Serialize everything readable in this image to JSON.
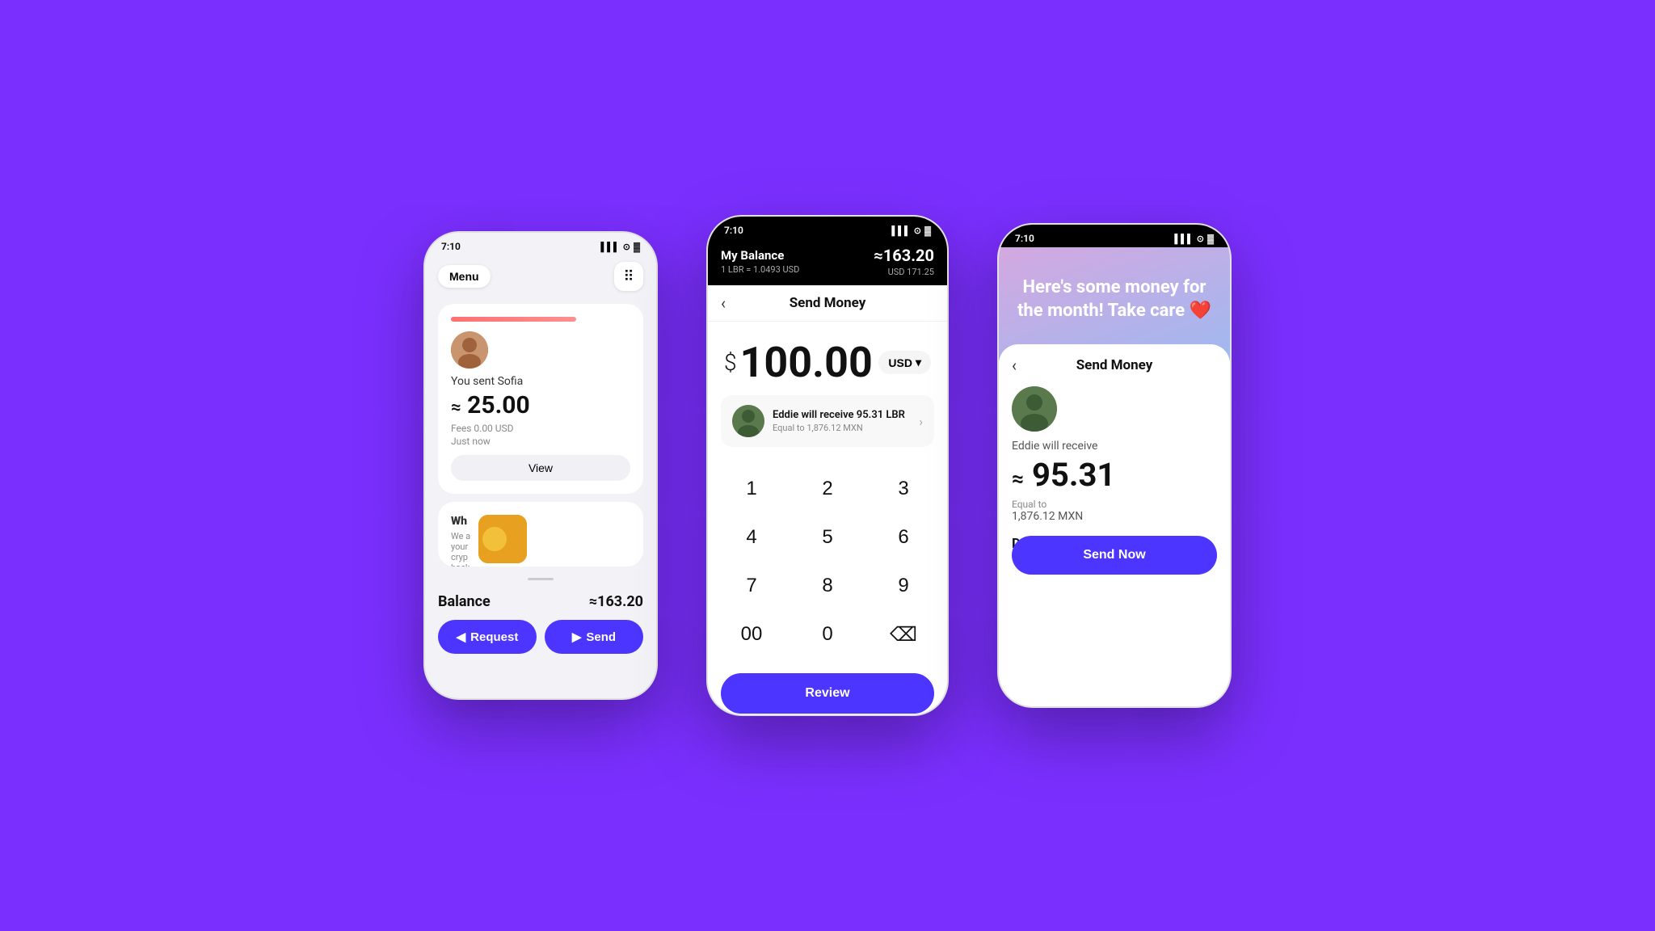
{
  "background": "#7B2FFF",
  "phone1": {
    "statusbar": {
      "time": "7:10",
      "icons": "▲ ▌▌▌ ⊙ 🔋"
    },
    "header": {
      "menu_label": "Menu",
      "qr_icon": "⠿"
    },
    "transaction": {
      "sent_label": "You sent Sofia",
      "amount": "≈ 25.00",
      "fees": "Fees 0.00 USD",
      "time": "Just now",
      "view_label": "View"
    },
    "partial_card": {
      "title": "Wh",
      "body": "We a your cryp back"
    },
    "footer": {
      "balance_label": "Balance",
      "balance_value": "≈163.20",
      "request_label": "Request",
      "send_label": "Send"
    }
  },
  "phone2": {
    "statusbar": {
      "time": "7:10",
      "icons": "▲ ▌▌▌ ⊙ 🔋"
    },
    "topbar": {
      "title": "My Balance",
      "subtitle": "1 LBR = 1.0493 USD",
      "amount": "≈163.20",
      "usd": "USD 171.25"
    },
    "nav": {
      "back_icon": "‹",
      "title": "Send Money"
    },
    "amount": {
      "dollar_sign": "$",
      "value": "100.00",
      "currency": "USD",
      "currency_chevron": "▾"
    },
    "recipient": {
      "name": "Eddie will receive 95.31 LBR",
      "sub": "Equal to 1,876.12 MXN",
      "chevron": "›"
    },
    "numpad": {
      "keys": [
        "1",
        "2",
        "3",
        "4",
        "5",
        "6",
        "7",
        "8",
        "9",
        "00",
        "0",
        "⌫"
      ]
    },
    "review_label": "Review"
  },
  "phone3": {
    "statusbar": {
      "time": "7:10",
      "icons": "▲ ▌▌▌ ⊙ 🔋"
    },
    "hero": {
      "text": "Here's some money for the month! Take care ❤️"
    },
    "nav": {
      "back_icon": "‹",
      "title": "Send Money"
    },
    "receiver": {
      "label": "Eddie will receive",
      "amount": "≈95.31",
      "equal_label": "Equal to",
      "equal_value": "1,876.12 MXN"
    },
    "details_title": "Details",
    "send_now_label": "Send Now"
  }
}
